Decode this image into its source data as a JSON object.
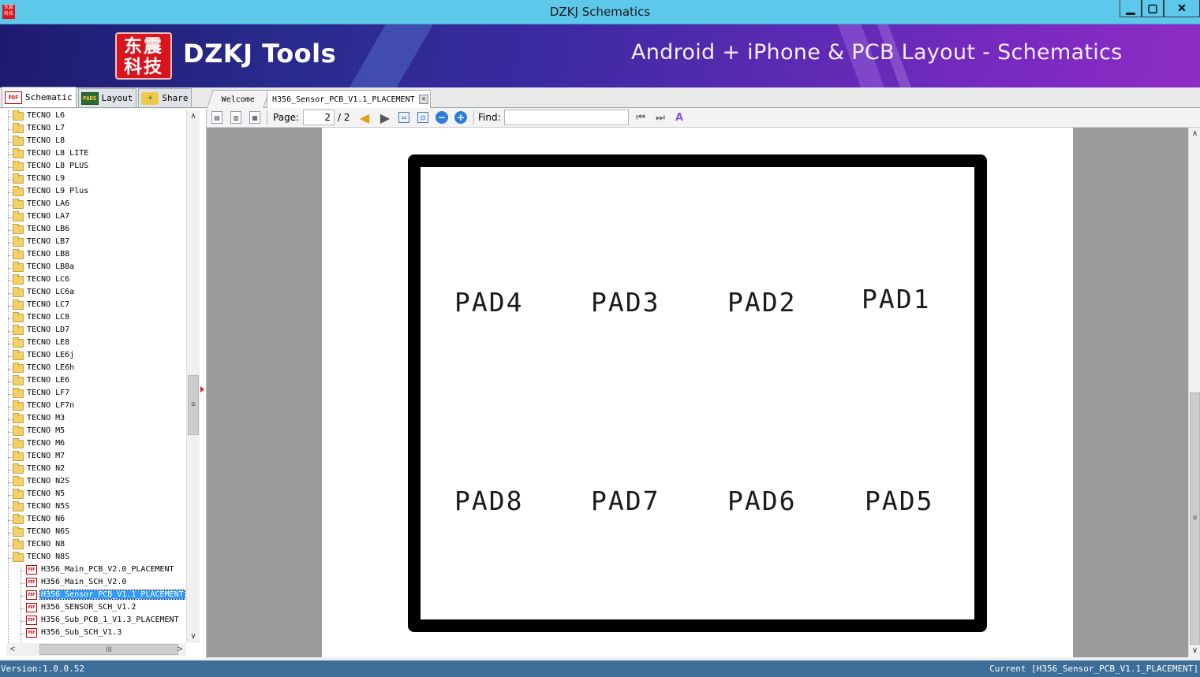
{
  "window": {
    "title": "DZKJ Schematics",
    "app_icon_text": "东震科技",
    "minimize_glyph": "▁",
    "maximize_glyph": "▢",
    "close_glyph": "✕"
  },
  "banner": {
    "logo_text": "东震科技",
    "brand": "DZKJ Tools",
    "tagline": "Android + iPhone & PCB Layout - Schematics",
    "colors": {
      "start": "#1e1a6e",
      "end": "#8e2cc4",
      "logo": "#d8141c"
    }
  },
  "left_tabs": [
    {
      "label": "Schematic",
      "icon": "pdf-icon",
      "icon_text": "PDF",
      "active": true
    },
    {
      "label": "Layout",
      "icon": "pads-icon",
      "icon_text": "PADS",
      "active": false
    },
    {
      "label": "Share",
      "icon": "share-folder-icon",
      "icon_text": "+",
      "active": false
    }
  ],
  "doc_tabs": [
    {
      "label": "Welcome"
    },
    {
      "label": "H356_Sensor_PCB_V1.1_PLACEMENT",
      "close": "✕"
    }
  ],
  "tree": {
    "folders": [
      "TECNO L6",
      "TECNO L7",
      "TECNO L8",
      "TECNO L8 LITE",
      "TECNO L8 PLUS",
      "TECNO L9",
      "TECNO L9 Plus",
      "TECNO LA6",
      "TECNO LA7",
      "TECNO LB6",
      "TECNO LB7",
      "TECNO LB8",
      "TECNO LB8a",
      "TECNO LC6",
      "TECNO LC6a",
      "TECNO LC7",
      "TECNO LC8",
      "TECNO LD7",
      "TECNO LE8",
      "TECNO LE6j",
      "TECNO LE6h",
      "TECNO LE6",
      "TECNO LF7",
      "TECNO LF7n",
      "TECNO M3",
      "TECNO M5",
      "TECNO M6",
      "TECNO M7",
      "TECNO N2",
      "TECNO N2S",
      "TECNO N5",
      "TECNO N5S",
      "TECNO N6",
      "TECNO N6S",
      "TECNO N8",
      "TECNO N8S"
    ],
    "files": [
      {
        "label": "H356_Main_PCB_V2.0_PLACEMENT",
        "selected": false
      },
      {
        "label": "H356_Main_SCH_V2.0",
        "selected": false
      },
      {
        "label": "H356_Sensor_PCB_V1.1_PLACEMENT",
        "selected": true
      },
      {
        "label": "H356_SENSOR_SCH_V1.2",
        "selected": false
      },
      {
        "label": "H356_Sub_PCB_1_V1.3_PLACEMENT",
        "selected": false
      },
      {
        "label": "H356_Sub_SCH_V1.3",
        "selected": false
      }
    ],
    "file_icon_text": "PDF",
    "scroll_up": "∧",
    "scroll_down": "∨",
    "scroll_left": "<",
    "scroll_right": ">",
    "vthumb_grip": "≡",
    "hthumb_grip": "III"
  },
  "toolbar": {
    "page_label": "Page:",
    "page_current": "2",
    "page_total": "/ 2",
    "find_label": "Find:",
    "find_value": ""
  },
  "document": {
    "pads_top": [
      "PAD4",
      "PAD3",
      "PAD2",
      "PAD1"
    ],
    "pads_bottom": [
      "PAD8",
      "PAD7",
      "PAD6",
      "PAD5"
    ]
  },
  "viewer_scroll": {
    "up": "∧",
    "down": "∨",
    "grip": "≡"
  },
  "status": {
    "version": "Version:1.0.0.52",
    "current": "Current [H356_Sensor_PCB_V1.1_PLACEMENT]"
  }
}
